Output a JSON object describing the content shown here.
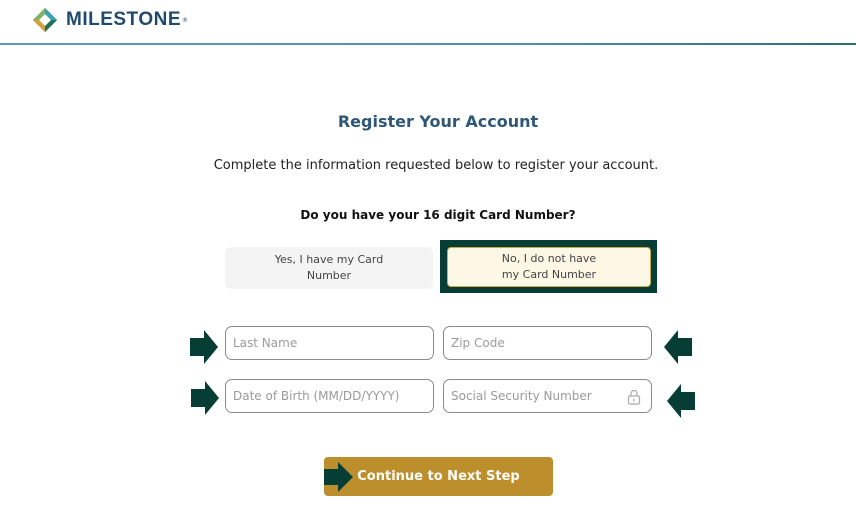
{
  "header": {
    "brand": "MILESTONE",
    "brand_mark": "®",
    "logo_icon": "milestone-diamond-logo"
  },
  "main": {
    "title": "Register Your Account",
    "subtitle": "Complete the information requested below to register your account.",
    "question": "Do you have your 16 digit Card Number?",
    "choices": [
      {
        "label_line1": "Yes, I have my Card",
        "label_line2": "Number",
        "selected": false
      },
      {
        "label_line1": "No, I do not have",
        "label_line2": "my Card Number",
        "selected": true
      }
    ],
    "fields": {
      "last_name": {
        "placeholder": "Last Name",
        "value": ""
      },
      "zip_code": {
        "placeholder": "Zip Code",
        "value": ""
      },
      "dob": {
        "placeholder": "Date of Birth (MM/DD/YYYY)",
        "value": ""
      },
      "ssn": {
        "placeholder": "Social Security Number",
        "value": "",
        "icon": "lock-icon"
      }
    },
    "continue_label": "Continue to Next Step"
  },
  "colors": {
    "brand_blue": "#1f4a6e",
    "title_blue": "#2e5778",
    "highlight_green": "#063d35",
    "button_gold": "#bd8f2c",
    "selected_fill": "#fdf7e6"
  }
}
